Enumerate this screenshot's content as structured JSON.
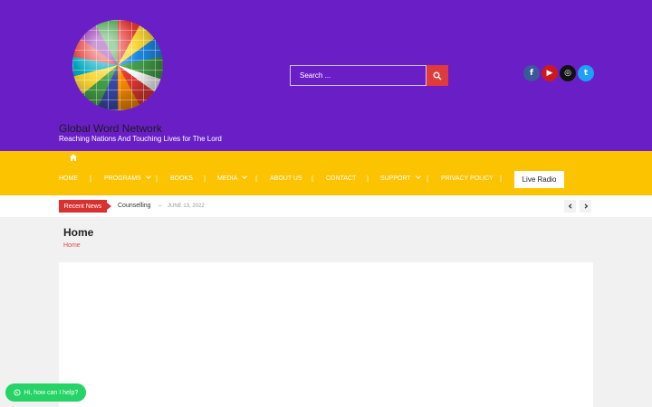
{
  "site": {
    "title": "Global Word Network",
    "tagline": "Reaching Nations And Touching Lives for The Lord"
  },
  "search": {
    "placeholder": "Search ...",
    "button_icon": "search-icon"
  },
  "social": [
    {
      "name": "facebook",
      "glyph": "f",
      "color": "#3b5998"
    },
    {
      "name": "youtube",
      "glyph": "▶",
      "color": "#cc181e"
    },
    {
      "name": "instagram",
      "glyph": "◎",
      "color": "#111111"
    },
    {
      "name": "twitter",
      "glyph": "t",
      "color": "#1da1f2"
    }
  ],
  "nav": {
    "home_icon": "home-icon",
    "items": [
      "HOME",
      "PROGRAMS",
      "BOOKS",
      "MEDIA",
      "ABOUT US",
      "CONTACT",
      "SUPPORT",
      "PRIVACY POLICY"
    ],
    "live_label": "Live Radio"
  },
  "ticker": {
    "label": "Recent News",
    "title": "Counselling",
    "date": "JUNE 13, 2022"
  },
  "page": {
    "heading": "Home",
    "breadcrumb": "Home"
  },
  "whatsapp": {
    "label": "Hi, how can I help?"
  },
  "colors": {
    "header_bg": "#6a1fc6",
    "nav_bg": "#fcc400",
    "accent_red": "#d93030",
    "whatsapp_green": "#25d366"
  }
}
